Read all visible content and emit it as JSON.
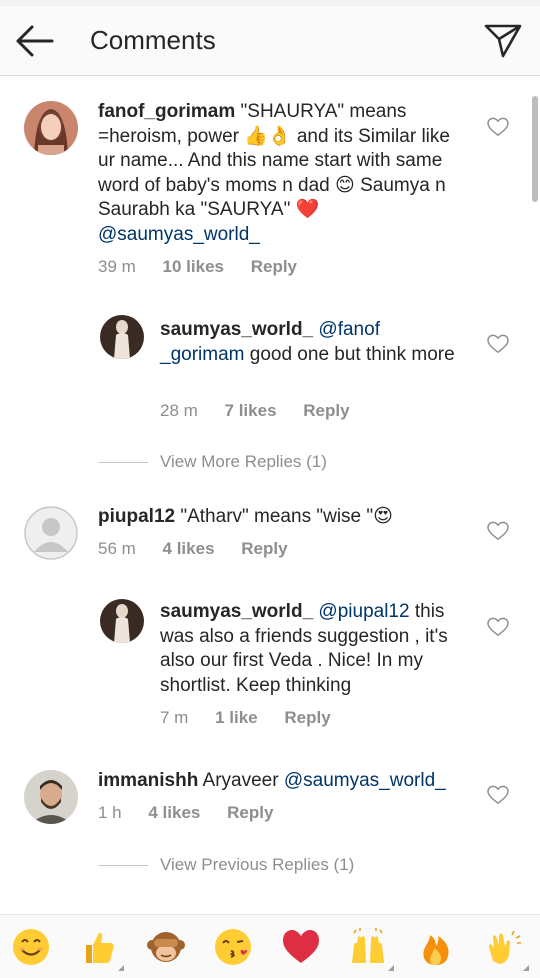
{
  "header": {
    "title": "Comments"
  },
  "comments": [
    {
      "username": "fanof_gorimam",
      "text": "\"SHAURYA\" means =heroism, power 👍👌 and its Similar like ur name... And this name start with same word of baby's moms n dad 😊 Saumya n Saurabh ka \"SAURYA\" ❤️",
      "mention": "@saumyas_world_",
      "time": "39 m",
      "likes": "10 likes",
      "reply": "Reply",
      "replies": [
        {
          "username": "saumyas_world_",
          "mention": "@fanof _gorimam",
          "text": "good one but think more",
          "time": "28 m",
          "likes": "7 likes",
          "reply": "Reply"
        }
      ],
      "view_more": "View More Replies (1)"
    },
    {
      "username": "piupal12",
      "text": "\"Atharv\" means \"wise \"😍",
      "time": "56 m",
      "likes": "4 likes",
      "reply": "Reply",
      "replies": [
        {
          "username": "saumyas_world_",
          "mention": "@piupal12",
          "text": "this was also a friends suggestion , it's also our first Veda . Nice! In my shortlist. Keep thinking",
          "time": "7 m",
          "likes": "1 like",
          "reply": "Reply"
        }
      ]
    },
    {
      "username": "immanishh",
      "text": "Aryaveer",
      "mention": "@saumyas_world_",
      "time": "1 h",
      "likes": "4 likes",
      "reply": "Reply",
      "view_previous": "View Previous Replies (1)"
    }
  ],
  "emoji_bar": [
    "smiling-face",
    "thumbs-up",
    "see-no-evil-monkey",
    "kissing-face",
    "red-heart",
    "raised-hands",
    "fire",
    "clapping-hands"
  ],
  "colors": {
    "text": "#262626",
    "meta": "#8e8e8e",
    "mention": "#003569",
    "header_bg": "#fafafa"
  }
}
